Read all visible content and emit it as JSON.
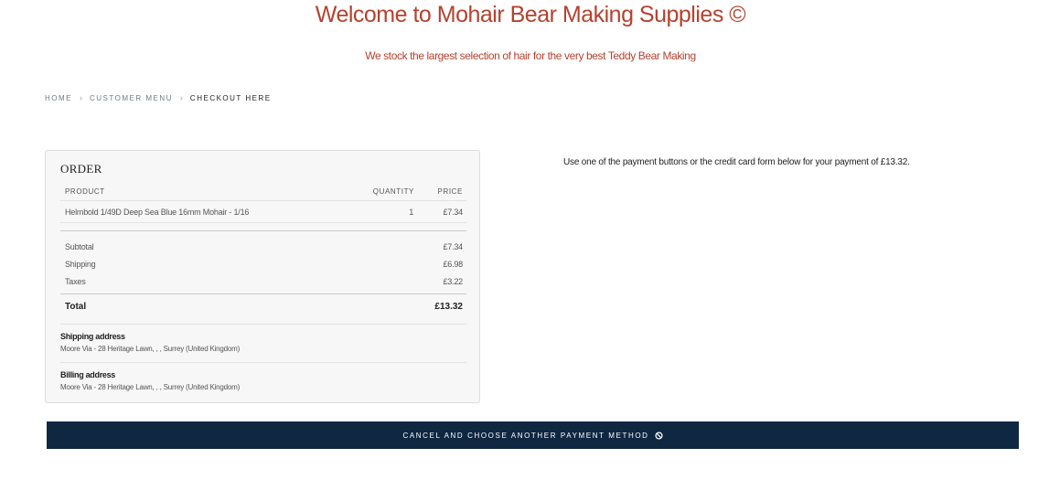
{
  "header": {
    "title": "Welcome to Mohair Bear Making Supplies ©",
    "tagline": "We stock the largest selection of hair for the very best Teddy Bear Making"
  },
  "breadcrumb": {
    "items": [
      "HOME",
      "CUSTOMER MENU",
      "CHECKOUT HERE"
    ],
    "separator": "›"
  },
  "order": {
    "heading": "ORDER",
    "columns": {
      "product": "PRODUCT",
      "quantity": "QUANTITY",
      "price": "PRICE"
    },
    "items": [
      {
        "product": "Helmbold 1/49D Deep Sea Blue 16mm Mohair - 1/16",
        "quantity": "1",
        "price": "£7.34"
      }
    ],
    "subtotal_label": "Subtotal",
    "subtotal_value": "£7.34",
    "shipping_label": "Shipping",
    "shipping_value": "£6.98",
    "taxes_label": "Taxes",
    "taxes_value": "£3.22",
    "total_label": "Total",
    "total_value": "£13.32",
    "shipping_address_label": "Shipping address",
    "shipping_address": "Moore Via - 28 Heritage Lawn, , , Surrey (United Kingdom)",
    "billing_address_label": "Billing address",
    "billing_address": "Moore Via - 28 Heritage Lawn, , , Surrey (United Kingdom)"
  },
  "payment": {
    "message": "Use one of the payment buttons or the credit card form below for your payment of £13.32."
  },
  "cancel_button": {
    "label": "CANCEL AND CHOOSE ANOTHER PAYMENT METHOD",
    "icon": "ban-icon"
  },
  "colors": {
    "title": "#b5412e",
    "button_bg": "#0f2741"
  }
}
